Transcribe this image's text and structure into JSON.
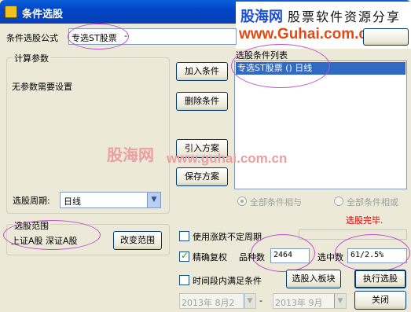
{
  "window": {
    "title": "条件选股"
  },
  "watermark": {
    "brand": "股海网",
    "tagline": "股票软件资源分享",
    "url": "www.Guhai.com.cn",
    "center_brand": "股海网",
    "center_url": "www.guhai.com.cn"
  },
  "formula": {
    "label": "条件选股公式",
    "value": "专选ST股票"
  },
  "params": {
    "group_title": "计算参数",
    "message": "无参数需要设置"
  },
  "period": {
    "label": "选股周期:",
    "value": "日线"
  },
  "scope": {
    "group_title": "选股范围",
    "value": "上证A股 深证A股",
    "change_button": "改变范围"
  },
  "buttons": {
    "add": "加入条件",
    "delete": "删除条件",
    "import": "引入方案",
    "save": "保存方案",
    "to_block": "选股入板块",
    "execute": "执行选股",
    "close": "关闭"
  },
  "condition_list": {
    "title": "选股条件列表",
    "items": [
      "专选ST股票  () 日线"
    ]
  },
  "logic": {
    "all_and": "全部条件相与",
    "all_or": "全部条件相或"
  },
  "status": {
    "text": "选股完毕.",
    "color": "#e00000"
  },
  "options": {
    "use_adjust": "使用涨跌不定周期",
    "precise": "精确复权",
    "time_range": "时间段内满足条件"
  },
  "stats": {
    "count_label": "品种数",
    "count_value": "2464",
    "selected_label": "选中数",
    "selected_value": "61/2.5%"
  },
  "date_range": {
    "start": "2013年 8月2",
    "dash": "-",
    "end": "2013年 9月"
  }
}
